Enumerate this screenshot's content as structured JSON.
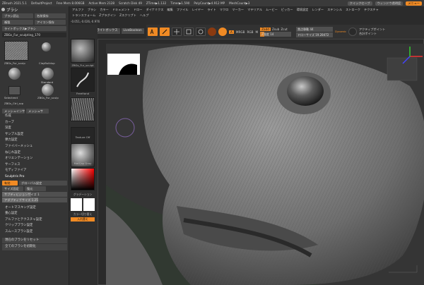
{
  "statusbar": {
    "app": "ZBrush 2021.5.1",
    "project": "DefaultProject",
    "free_mem": "Free Mem 8.006GB",
    "active_mem": "Active Mem 2128",
    "scratch": "Scratch Disk 49",
    "ztime": "ZTime▶1.132",
    "timer": "Timer▶1.590",
    "polycount": "PolyCount▶4.912 MP",
    "meshcount": "MeshCount▶3",
    "quicksave": "クイックセーブ",
    "window": "ウィンドウ透明度",
    "menu": "メニュー"
  },
  "menu": {
    "row1": [
      "アルファ",
      "ブラシ",
      "カラー",
      "ドキュメント",
      "ドロー",
      "ダイナミクス",
      "編集",
      "ファイル",
      "レイヤー",
      "ライト",
      "マクロ",
      "マーカー",
      "マテリアル",
      "ムービー",
      "ピッカー",
      "環境設定",
      "レンダー",
      "ステンシル",
      "ストローク",
      "テクスチャ"
    ],
    "row2": [
      "トランスフォーム",
      "Zプラグイン",
      "Zスクリプト",
      "ヘルプ"
    ],
    "coords": "-0.051,-0.026,-0.976"
  },
  "tabs": [
    "ホームページ",
    "ライトボックス",
    "LiveBoolean"
  ],
  "leftpanel": {
    "title": "ブラシ",
    "btn_load": "ブラシ読込",
    "btn_save": "名前保存",
    "btn_clone": "複製",
    "btn_icon": "アイコン保存",
    "btn_lightbox": "ライトボックス▶ブラシ",
    "current_brush": "ZBGs_Fur_sculpting_170",
    "brushes": [
      "ZBGs_Fur_sculp",
      "ClayBuildup",
      "Standard",
      "Selectrect",
      "ZBGs_Fur_sculp",
      "ZBGs_Ctrl_scp"
    ],
    "btn_mesh": "メッシュインサ",
    "btn_mesh2": "メッシュサ",
    "list": [
      "作成",
      "カーブ",
      "深度",
      "サンプル設定",
      "弾力設定",
      "ファイバーメッシュ",
      "ねじれ設定",
      "オリエンテーション",
      "サーフェス",
      "モディファイア"
    ],
    "sculptris": "Sculptris Pro",
    "sp_enable": "有効",
    "sp_global": "グローバル設定",
    "sp_size": "サイズ固定",
    "sp_undo": "復元",
    "sp_subdiv": "サブディビジョンサイズ 1",
    "sp_subdiv_level": 0.45,
    "sp_adaptive": "アダプティブサイズ 1.25",
    "sp_adaptive_level": 0.55,
    "list2": [
      "オートマスキング設定",
      "重心設定",
      "アルファとテクスチャ設定",
      "クリップブラシ設定",
      "スムースブラシ設定"
    ],
    "reset": "現在のブラシをリセット",
    "reset_all": "全てのブラシを初期化"
  },
  "col2": {
    "home": "ホームページ",
    "tile1": "ZBGs_Fur_sculpt",
    "tile2": "FreeHand",
    "tile3": "",
    "tile4": "Texture Off",
    "tile5": "MatCap Gray",
    "gradient": "グラデーション",
    "swap": "カラー切り替え",
    "swap2": "入れ替え"
  },
  "toolbar": {
    "edit": "編集",
    "draw": "ドロー",
    "move": "移動",
    "scale": "スケール",
    "rotate": "回転",
    "a": "A",
    "mrgb": "MRGB",
    "rgb": "RGB",
    "m": "M",
    "zadd": "Zadd",
    "zsub": "Zsub",
    "zcut": "Zcut",
    "intensity_label": "Z強度",
    "intensity": "14",
    "intensity_level": 0.14,
    "focal_label": "焦点移動",
    "focal": "44",
    "drawsize_label": "ドローサイズ",
    "drawsize": "19.28472",
    "dynamic": "Dynamic",
    "activepoints": "アクティブポイント",
    "totalpoints": "合計ポイント"
  },
  "colors": {
    "accent": "#f08a24",
    "panel": "#353535",
    "viewport": "#353535"
  }
}
